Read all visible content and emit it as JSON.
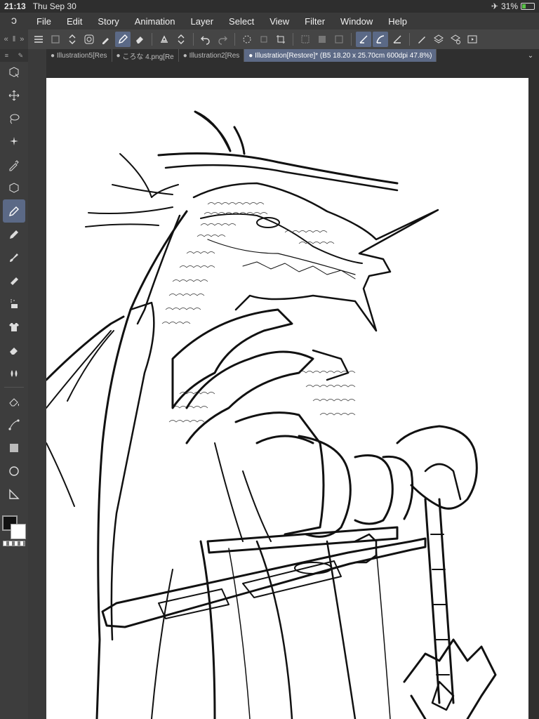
{
  "status": {
    "time": "21:13",
    "date": "Thu Sep 30",
    "battery_text": "31%",
    "battery_level": 0.31,
    "airplane_icon": "airplane-icon"
  },
  "menu": [
    "File",
    "Edit",
    "Story",
    "Animation",
    "Layer",
    "Select",
    "View",
    "Filter",
    "Window",
    "Help"
  ],
  "tabs": [
    {
      "label": "Illustration5[Res"
    },
    {
      "label": "ころな 4.png[Re"
    },
    {
      "label": "Illustration2[Res"
    },
    {
      "label": "Illustration[Restore]* (B5 18.20 x 25.70cm 600dpi 47.8%)"
    }
  ],
  "tools": [
    "sub-tool-icon",
    "move-icon",
    "lasso-icon",
    "auto-select-icon",
    "eyedropper-icon",
    "object-select-icon",
    "pen-icon",
    "pencil-icon",
    "brush-icon",
    "airbrush-icon",
    "decoration-icon",
    "shirt-icon",
    "eraser-icon",
    "blend-icon",
    "fill-icon",
    "vector-icon",
    "gradient-icon",
    "figure-icon",
    "ruler-icon"
  ],
  "toolbar_icons": [
    "menu-icon",
    "new-layer-icon",
    "stepper-icon",
    "spiral-icon",
    "eyedrop-icon",
    "pen-icon",
    "eraser-icon",
    "fill-bucket-icon",
    "stepper2-icon",
    "undo-icon",
    "redo-icon",
    "loading-icon",
    "transform-icon",
    "crop-icon",
    "select-none-icon",
    "invert-icon",
    "select-icon",
    "ruler-snap-icon",
    "curve-snap-icon",
    "line-snap-icon",
    "pencil-icon",
    "layer-icon",
    "layers-icon",
    "animation-icon"
  ],
  "colors": {
    "accent": "#5b6986",
    "main_color": "#111111",
    "sub_color": "#ffffff"
  }
}
